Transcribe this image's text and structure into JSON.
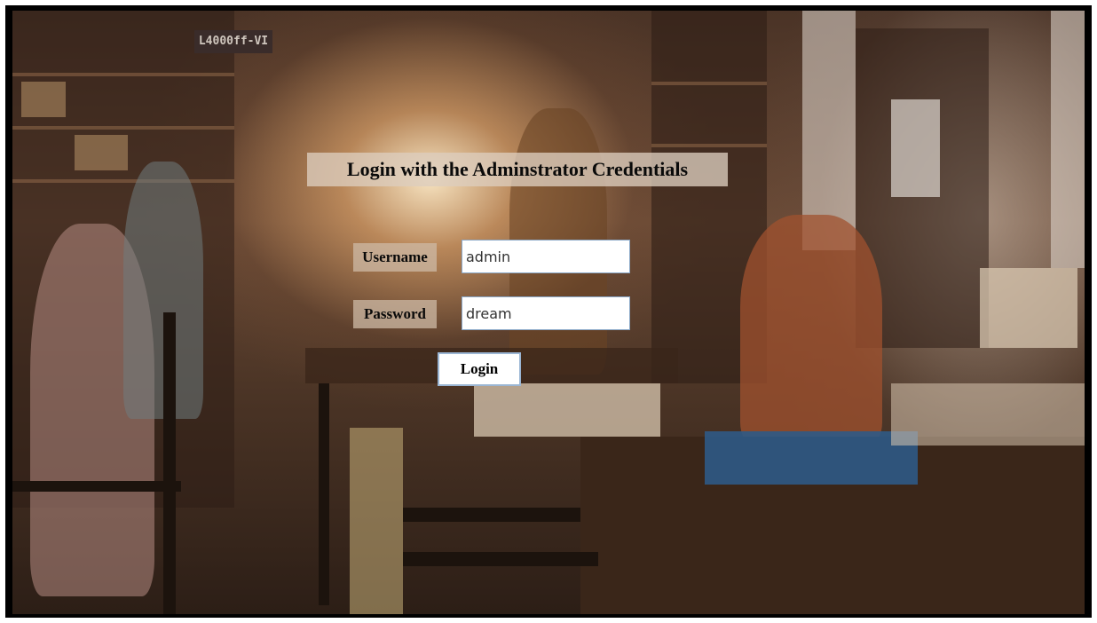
{
  "page": {
    "heading": "Login with the Adminstrator Credentials"
  },
  "form": {
    "username_label": "Username",
    "username_value": "admin",
    "password_label": "Password",
    "password_value": "dream",
    "login_label": "Login"
  },
  "background": {
    "sign_text": "L4000ff-VI"
  },
  "colors": {
    "frame": "#000000",
    "input_border": "#8aa8c8",
    "button_border": "#9bb6d4"
  }
}
